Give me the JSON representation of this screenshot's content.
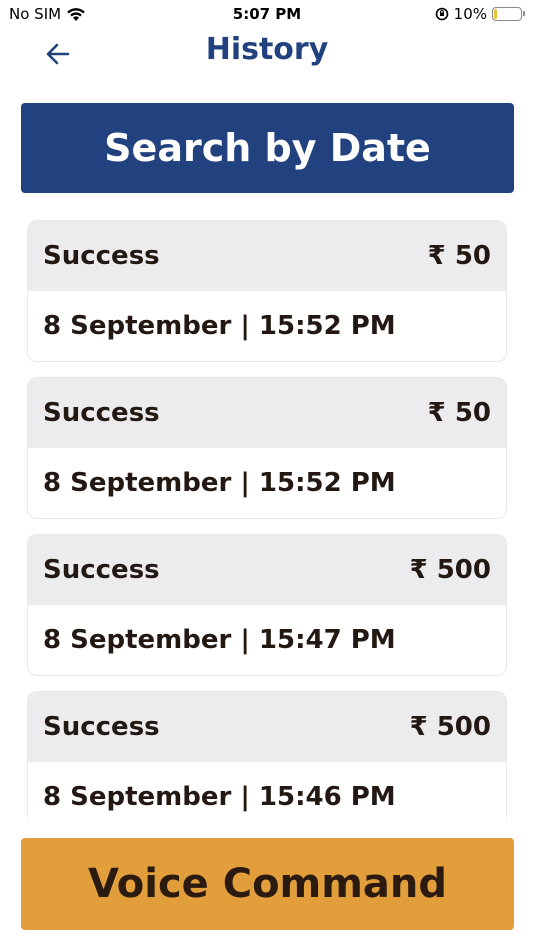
{
  "status_bar": {
    "carrier": "No SIM",
    "time": "5:07 PM",
    "battery_percent": "10%",
    "battery_level": 0.1,
    "icons": [
      "wifi-icon",
      "orientation-lock-icon",
      "battery-icon"
    ]
  },
  "nav": {
    "title": "History",
    "back_icon": "arrow-left-icon"
  },
  "search_button": {
    "label": "Search by Date"
  },
  "transactions": [
    {
      "status": "Success",
      "amount": "₹ 50",
      "datetime": "8 September | 15:52 PM"
    },
    {
      "status": "Success",
      "amount": "₹ 50",
      "datetime": "8 September | 15:52 PM"
    },
    {
      "status": "Success",
      "amount": "₹ 500",
      "datetime": "8 September | 15:47 PM"
    },
    {
      "status": "Success",
      "amount": "₹ 500",
      "datetime": "8 September | 15:46 PM"
    }
  ],
  "voice_button": {
    "label": "Voice Command"
  },
  "colors": {
    "primary": "#22427f",
    "accent": "#e29e3b",
    "card_header": "#ececef",
    "text": "#231812"
  }
}
